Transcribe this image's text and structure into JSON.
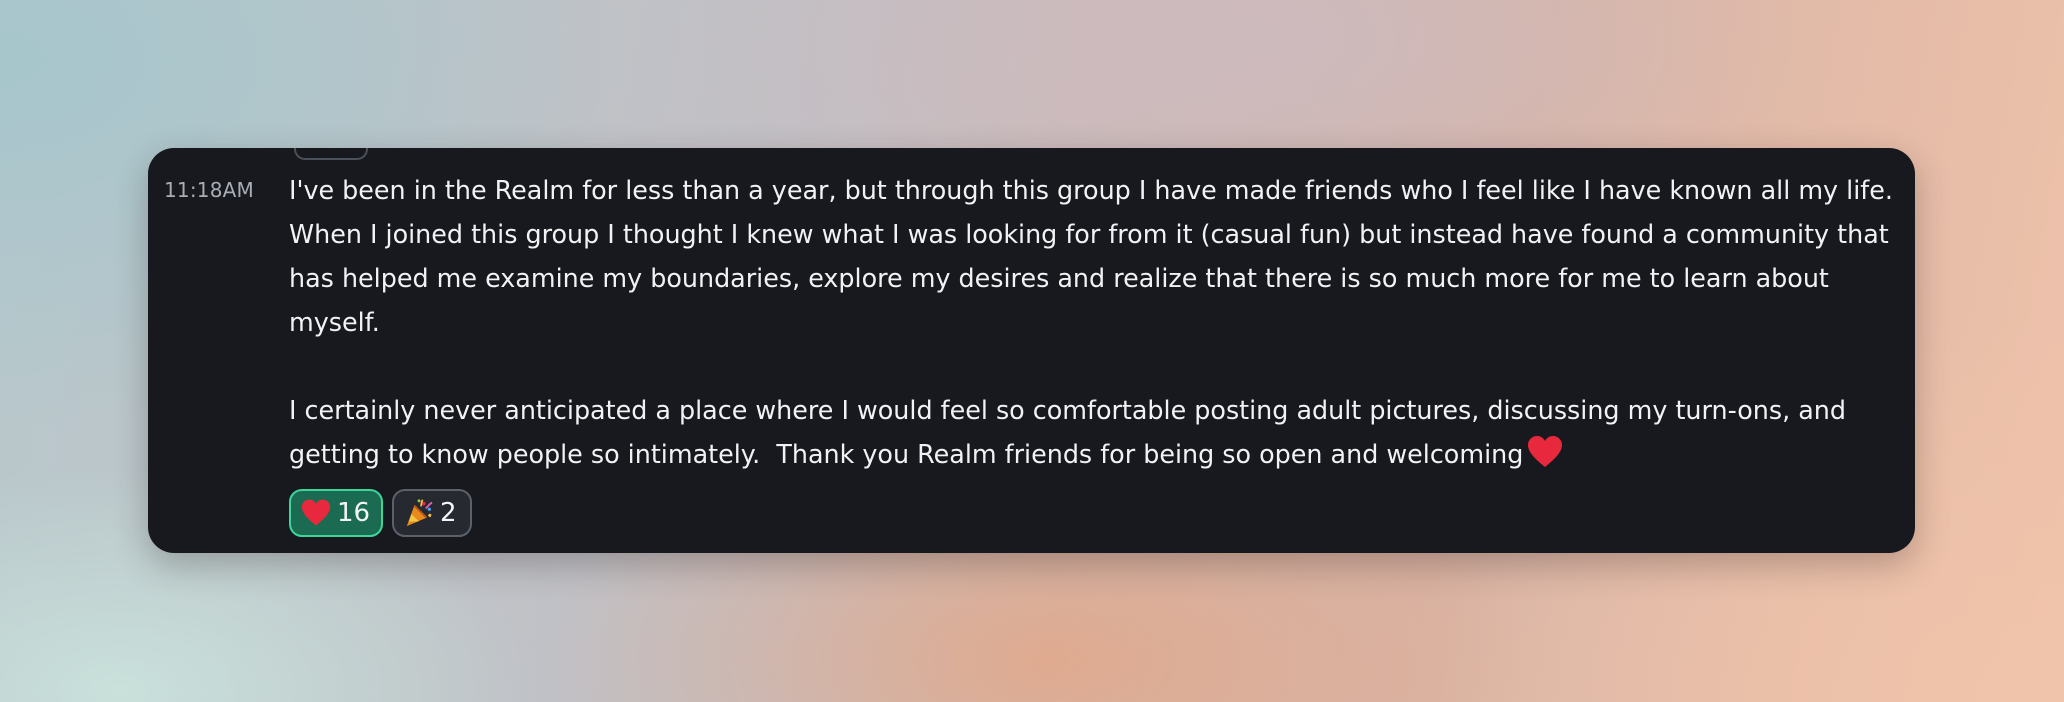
{
  "message": {
    "timestamp": "11:18AM",
    "paragraph1": "I've been in the Realm for less than a year, but through this group I have made friends who I feel like I have known all my life. When I joined this group I thought I knew what I was looking for from it (casual fun) but instead have found a community that has helped me examine my boundaries, explore my desires and realize that there is so much more for me to learn about myself.",
    "paragraph2": "I certainly never anticipated a place where I would feel so comfortable posting adult pictures, discussing my turn-ons, and getting to know people so intimately.  Thank you Realm friends for being so open and welcoming",
    "trailing_emoji": "heart-icon"
  },
  "reactions": [
    {
      "icon": "heart-icon",
      "count": "16",
      "selected": true
    },
    {
      "icon": "party-popper-icon",
      "count": "2",
      "selected": false
    }
  ],
  "colors": {
    "card_background": "#17191e",
    "text": "#f1f2f4",
    "timestamp": "#a8acb4",
    "heart": "#e8283c",
    "reaction_active_bg": "#1a6b52",
    "reaction_active_border": "#3ed59a",
    "reaction_idle_border": "#5b606a"
  }
}
